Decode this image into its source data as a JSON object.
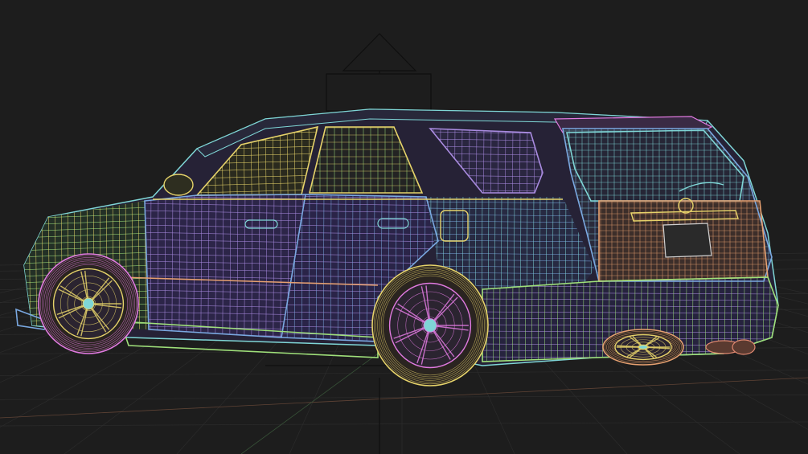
{
  "viewport": {
    "background": "#1d1d1d",
    "grid_color": "#2e2e2e",
    "axis_x_color": "#6b4a3a",
    "axis_z_color": "#3c5a3c"
  },
  "wire_colors": {
    "green": "#9fe07a",
    "yellow": "#e6d36a",
    "cyan": "#7fd6d6",
    "purple": "#a98be0",
    "magenta": "#e07ae0",
    "orange": "#e6a070",
    "blue": "#7aa8e0",
    "salmon": "#e08870"
  },
  "camera_gizmo_color": "#111111"
}
